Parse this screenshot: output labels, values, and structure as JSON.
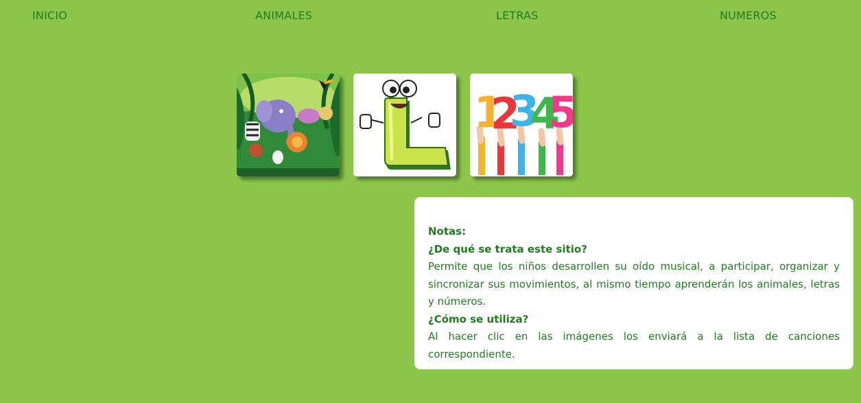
{
  "nav": {
    "items": [
      {
        "label": "INICIO"
      },
      {
        "label": "ANIMALES"
      },
      {
        "label": "LETRAS"
      },
      {
        "label": "NUMEROS"
      }
    ]
  },
  "cards": [
    {
      "name": "animales",
      "image": "jungle-animals-illustration"
    },
    {
      "name": "letras",
      "image": "cartoon-letter-l-thumbs-up"
    },
    {
      "name": "numeros",
      "image": "hands-holding-numbers-12345"
    }
  ],
  "notes": {
    "title": "Notas:",
    "q1": "¿De qué se trata este sitio?",
    "a1": "Permite que los niños desarrollen su oído musical, a participar, organizar y sincronizar sus movimientos, al mismo tiempo aprenderán los animales, letras y números.",
    "q2": "¿Cómo se utiliza?",
    "a2": "Al hacer clic en las imágenes los enviará a la lista de canciones correspondiente."
  },
  "numbers_image": {
    "digits": [
      "1",
      "2",
      "3",
      "4",
      "5"
    ]
  },
  "colors": {
    "background": "#8bc64b",
    "text": "#1f7d1f",
    "panel": "#ffffff"
  }
}
